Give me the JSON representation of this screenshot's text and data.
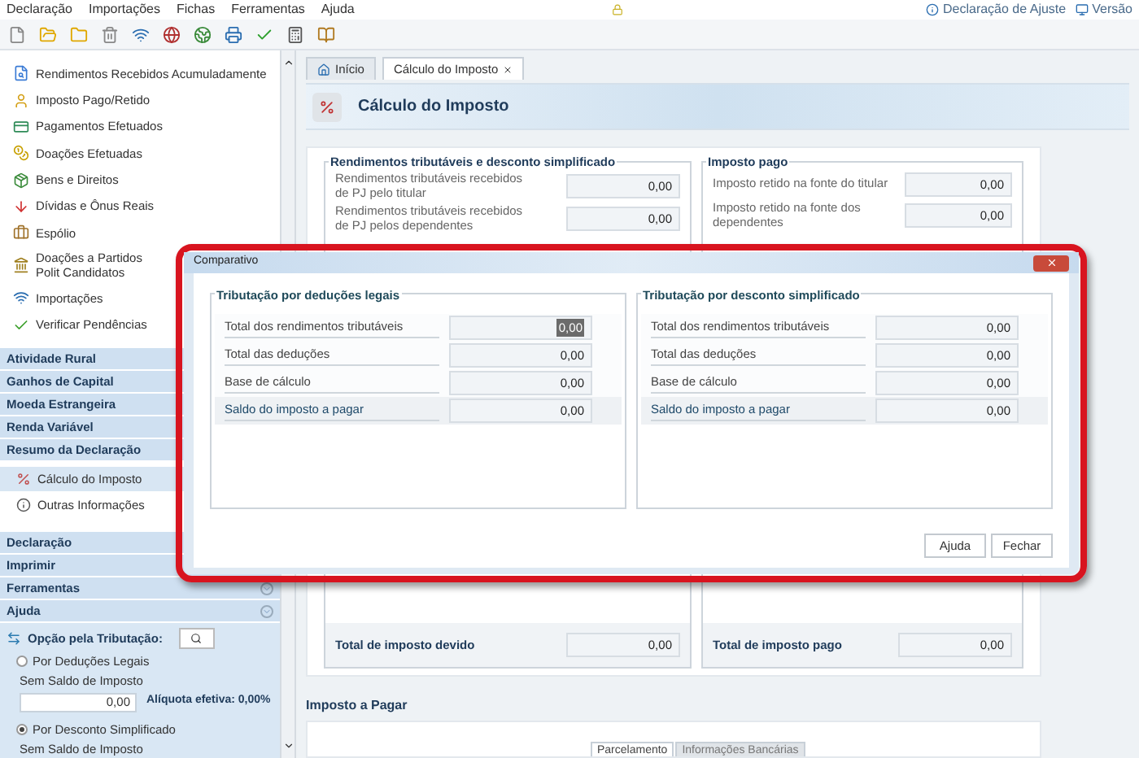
{
  "menu": [
    {
      "label": "Declaração"
    },
    {
      "label": "Importações"
    },
    {
      "label": "Fichas"
    },
    {
      "label": "Ferramentas"
    },
    {
      "label": "Ajuda"
    }
  ],
  "top_links": [
    "Declaração de Ajuste",
    "Versão"
  ],
  "sidebar": {
    "items": [
      {
        "label": "Rendimentos Recebidos Acumuladamente"
      },
      {
        "label": "Imposto Pago/Retido"
      },
      {
        "label": "Pagamentos Efetuados"
      },
      {
        "label": "Doações Efetuadas"
      },
      {
        "label": "Bens e Direitos"
      },
      {
        "label": "Dívidas e Ônus Reais"
      },
      {
        "label": "Espólio"
      },
      {
        "label": "Doações a Partidos Polit Candidatos"
      },
      {
        "label": "Importações"
      },
      {
        "label": "Verificar Pendências"
      }
    ],
    "sections": [
      {
        "label": "Atividade Rural"
      },
      {
        "label": "Ganhos de Capital"
      },
      {
        "label": "Moeda Estrangeira"
      },
      {
        "label": "Renda Variável"
      },
      {
        "label": "Resumo da Declaração"
      }
    ],
    "subitems": [
      {
        "label": "Cálculo do Imposto",
        "selected": true
      },
      {
        "label": "Outras Informações",
        "selected": false
      }
    ],
    "bottom_sections": [
      {
        "label": "Declaração",
        "kind": "plain"
      },
      {
        "label": "Imprimir",
        "kind": "plain"
      },
      {
        "label": "Ferramentas",
        "kind": "collapsible"
      },
      {
        "label": "Ajuda",
        "kind": "collapsible"
      }
    ]
  },
  "tax_option": {
    "title": "Opção pela Tributação:",
    "options": [
      {
        "label": "Por Deduções Legais",
        "selected": false,
        "status": "Sem Saldo de Imposto",
        "value": "0,00",
        "rate": "Alíquota efetiva: 0,00%"
      },
      {
        "label": "Por Desconto Simplificado",
        "selected": true,
        "status": "Sem Saldo de Imposto"
      }
    ]
  },
  "tabs": [
    {
      "label": "Início",
      "selected": false,
      "closable": false
    },
    {
      "label": "Cálculo do Imposto",
      "selected": true,
      "closable": true
    }
  ],
  "page_title": "Cálculo do Imposto",
  "groups": [
    {
      "title": "Rendimentos tributáveis e desconto simplificado",
      "rows": [
        {
          "label": "Rendimentos tributáveis recebidos de PJ pelo titular",
          "value": "0,00"
        },
        {
          "label": "Rendimentos tributáveis recebidos de PJ pelos dependentes",
          "value": "0,00"
        }
      ],
      "total": {
        "label": "Total de imposto devido",
        "value": "0,00"
      }
    },
    {
      "title": "Imposto pago",
      "rows": [
        {
          "label": "Imposto retido na fonte do titular",
          "value": "0,00"
        },
        {
          "label": "Imposto retido na fonte dos dependentes",
          "value": "0,00"
        }
      ],
      "total": {
        "label": "Total de imposto pago",
        "value": "0,00"
      }
    }
  ],
  "payment": {
    "title": "Imposto a Pagar",
    "tabs": [
      {
        "label": "Parcelamento",
        "selected": true
      },
      {
        "label": "Informações Bancárias",
        "selected": false
      }
    ]
  },
  "dialog": {
    "title": "Comparativo",
    "groups": [
      {
        "title": "Tributação por deduções legais",
        "rows": [
          {
            "label": "Total dos rendimentos tributáveis",
            "value": "0,00",
            "highlighted": false,
            "focused": true
          },
          {
            "label": "Total das deduções",
            "value": "0,00",
            "highlighted": false,
            "focused": false
          },
          {
            "label": "Base de cálculo",
            "value": "0,00",
            "highlighted": false,
            "focused": false
          },
          {
            "label": "Saldo do imposto a pagar",
            "value": "0,00",
            "highlighted": true,
            "focused": false
          }
        ]
      },
      {
        "title": "Tributação por desconto simplificado",
        "rows": [
          {
            "label": "Total dos rendimentos tributáveis",
            "value": "0,00",
            "highlighted": false,
            "focused": false
          },
          {
            "label": "Total das deduções",
            "value": "0,00",
            "highlighted": false,
            "focused": false
          },
          {
            "label": "Base de cálculo",
            "value": "0,00",
            "highlighted": false,
            "focused": false
          },
          {
            "label": "Saldo do imposto a pagar",
            "value": "0,00",
            "highlighted": true,
            "focused": false
          }
        ]
      }
    ],
    "buttons": [
      "Ajuda",
      "Fechar"
    ]
  }
}
